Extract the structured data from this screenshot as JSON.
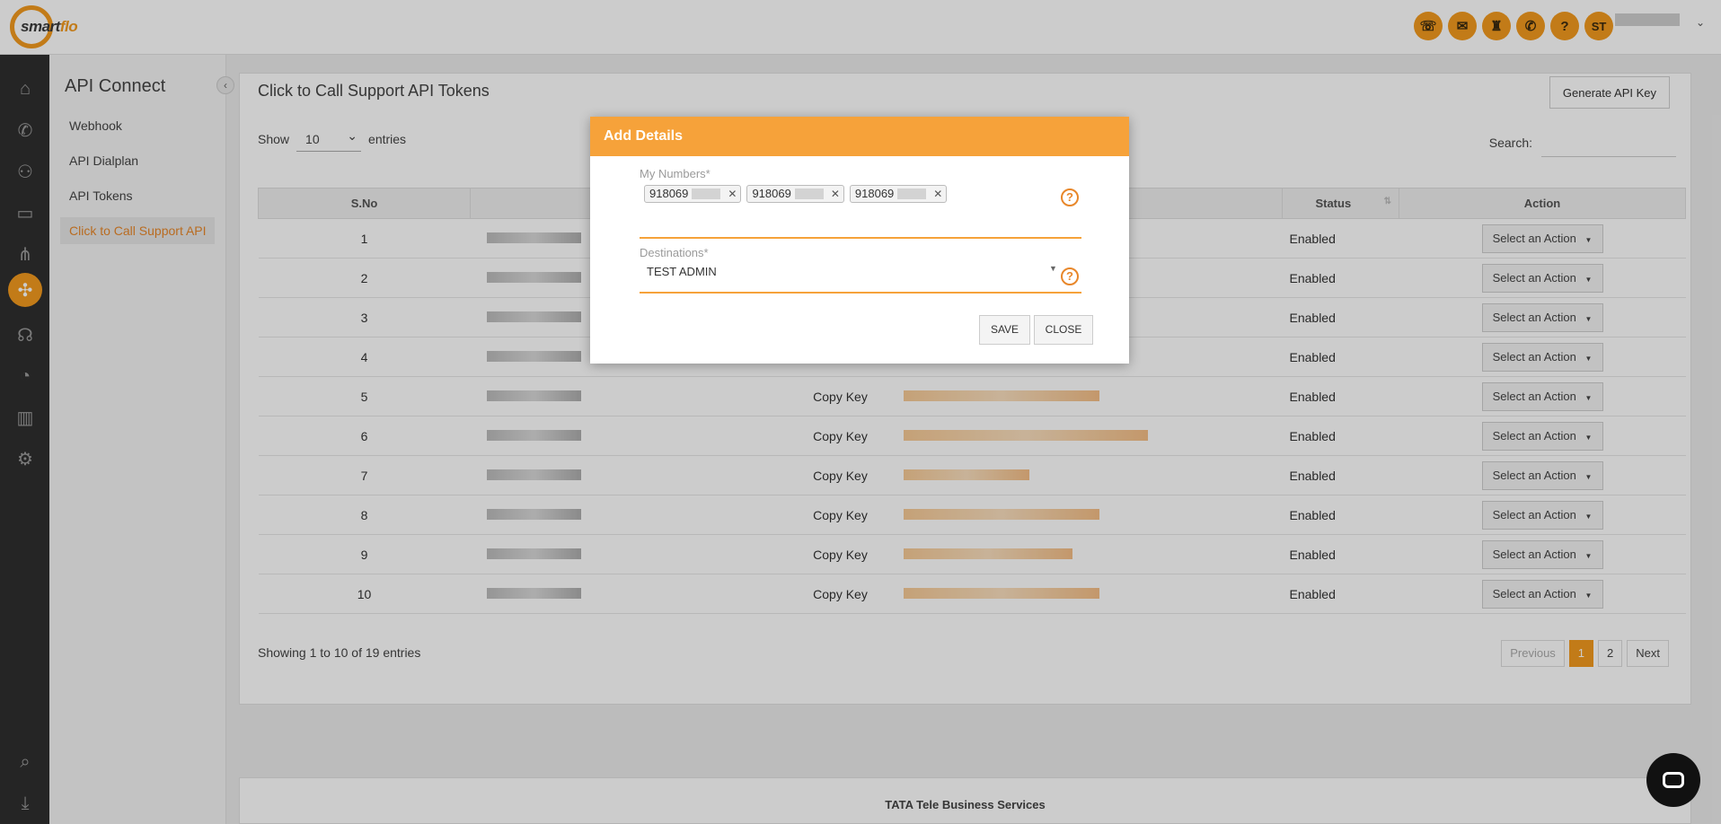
{
  "app": {
    "logo_text_a": "smart",
    "logo_text_b": "flo"
  },
  "topbar": {
    "icons": [
      "phone-call-icon",
      "sms-icon",
      "agent-icon",
      "phone-ring-icon",
      "help-icon"
    ],
    "help_glyph": "?",
    "user_initials": "ST"
  },
  "leftnav": {
    "icons": [
      "home-icon",
      "phone-icon",
      "users-icon",
      "monitor-icon",
      "network-icon",
      "api-connect-icon",
      "ear-icon",
      "pie-chart-icon",
      "bar-chart-icon",
      "settings-icon",
      "search-icon",
      "download-icon"
    ],
    "active": "api-connect-icon"
  },
  "subnav": {
    "title": "API Connect",
    "items": [
      {
        "label": "Webhook"
      },
      {
        "label": "API Dialplan"
      },
      {
        "label": "API Tokens"
      },
      {
        "label": "Click to Call Support API"
      }
    ]
  },
  "main": {
    "title": "Click to Call Support API Tokens",
    "generate_button": "Generate API Key",
    "show_label": "Show",
    "show_value": "10",
    "entries_label": "entries",
    "search_label": "Search:",
    "columns": {
      "sno": "S.No",
      "status": "Status",
      "action": "Action"
    },
    "rows": [
      {
        "sno": "1",
        "copy": "",
        "status": "Enabled",
        "action": "Select an Action"
      },
      {
        "sno": "2",
        "copy": "",
        "status": "Enabled",
        "action": "Select an Action"
      },
      {
        "sno": "3",
        "copy": "",
        "status": "Enabled",
        "action": "Select an Action"
      },
      {
        "sno": "4",
        "copy": "",
        "status": "Enabled",
        "action": "Select an Action"
      },
      {
        "sno": "5",
        "copy": "Copy Key",
        "status": "Enabled",
        "action": "Select an Action"
      },
      {
        "sno": "6",
        "copy": "Copy Key",
        "status": "Enabled",
        "action": "Select an Action"
      },
      {
        "sno": "7",
        "copy": "Copy Key",
        "status": "Enabled",
        "action": "Select an Action"
      },
      {
        "sno": "8",
        "copy": "Copy Key",
        "status": "Enabled",
        "action": "Select an Action"
      },
      {
        "sno": "9",
        "copy": "Copy Key",
        "status": "Enabled",
        "action": "Select an Action"
      },
      {
        "sno": "10",
        "copy": "Copy Key",
        "status": "Enabled",
        "action": "Select an Action"
      }
    ],
    "showing_text": "Showing 1 to 10 of 19 entries",
    "pagination": {
      "previous": "Previous",
      "pages": [
        "1",
        "2"
      ],
      "current": "1",
      "next": "Next"
    }
  },
  "footer": {
    "text": "TATA Tele Business Services"
  },
  "modal": {
    "title": "Add Details",
    "numbers_label": "My Numbers*",
    "numbers": [
      "918069",
      "918069",
      "918069"
    ],
    "destinations_label": "Destinations*",
    "destination_value": "TEST ADMIN",
    "help_glyph": "?",
    "save_label": "SAVE",
    "close_label": "CLOSE"
  }
}
